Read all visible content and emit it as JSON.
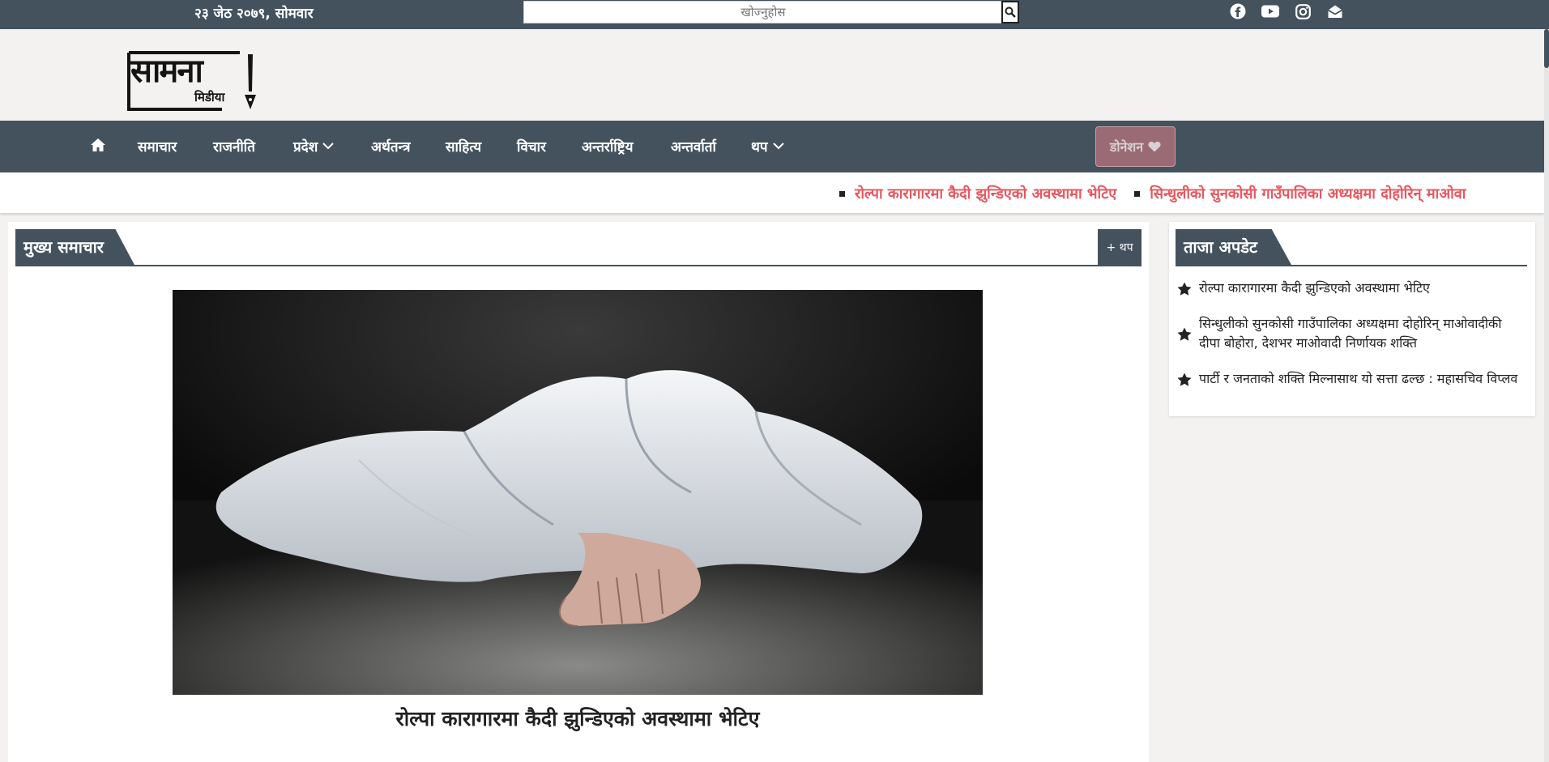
{
  "topbar": {
    "date": "२३ जेठ २०७९, सोमवार",
    "search_placeholder": "खोज्नुहोस",
    "social_icons": [
      "facebook-icon",
      "youtube-icon",
      "instagram-icon",
      "email-icon"
    ]
  },
  "logo": {
    "text_main": "सामना",
    "text_sub": "मिडीया"
  },
  "nav": {
    "items": [
      {
        "label": "समाचार"
      },
      {
        "label": "राजनीति"
      },
      {
        "label": "प्रदेश"
      },
      {
        "label": "अर्थतन्त्र"
      },
      {
        "label": "साहित्य"
      },
      {
        "label": "विचार"
      },
      {
        "label": "अन्तर्राष्ट्रिय"
      },
      {
        "label": "अन्तर्वार्ता"
      },
      {
        "label": "थप"
      }
    ],
    "donate_label": "डोनेशन"
  },
  "ticker": {
    "items": [
      "रोल्पा कारागारमा कैदी झुन्डिएको अवस्थामा भेटिए",
      "सिन्धुलीको सुनकोसी गाउँपालिका अध्यक्षमा दोहोरिन् माओवा"
    ]
  },
  "main": {
    "section_title": "मुख्य समाचार",
    "more_label": "+ थप",
    "headline": "रोल्पा कारागारमा कैदी झुन्डिएको अवस्थामा भेटिए"
  },
  "sidebar": {
    "section_title": "ताजा अपडेट",
    "items": [
      "रोल्पा कारागारमा कैदी झुन्डिएको अवस्थामा भेटिए",
      "सिन्धुलीको सुनकोसी गाउँपालिका अध्यक्षमा दोहोरिन् माओवादीकी दीपा बोहोरा, देशभर माओवादी निर्णायक शक्ति",
      "पार्टी र जनताको शक्ति मिल्नासाथ यो सत्ता ढल्छ : महासचिव विप्लव"
    ]
  },
  "colors": {
    "bar": "#44525e",
    "ticker_text": "#e8565e",
    "donate_bg": "#9a6b74",
    "page_bg": "#f3f2f1"
  }
}
